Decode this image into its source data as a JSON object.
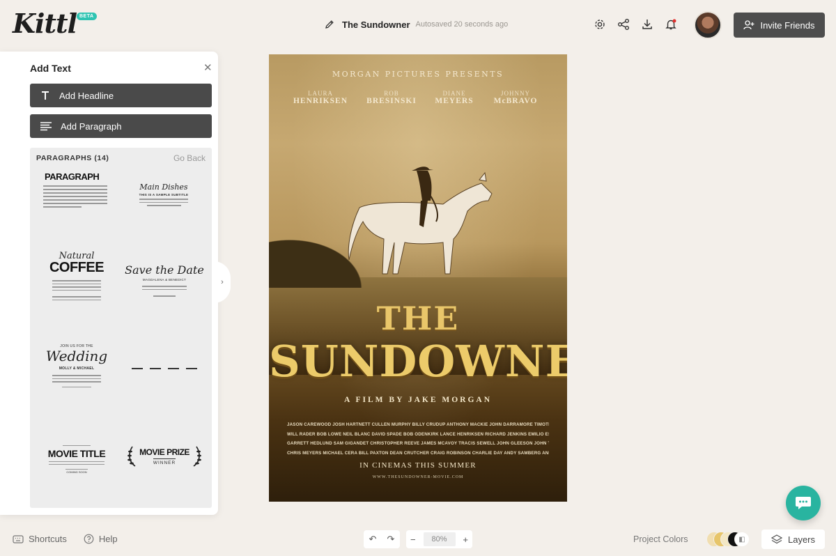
{
  "app": {
    "logo": "Kittl",
    "beta_badge": "BETA"
  },
  "document": {
    "name": "The Sundowner",
    "autosave": "Autosaved 20 seconds ago"
  },
  "header": {
    "invite_label": "Invite Friends"
  },
  "panel": {
    "title": "Add Text",
    "add_headline": "Add Headline",
    "add_paragraph": "Add Paragraph",
    "gallery_heading": "PARAGRAPHS (14)",
    "go_back": "Go Back",
    "tiles": [
      {
        "title": "PARAGRAPH"
      },
      {
        "title": "Main Dishes",
        "subtitle": "THIS IS A SAMPLE SUBTITLE"
      },
      {
        "title": "COFFEE",
        "script": "Natural"
      },
      {
        "title": "Save the Date",
        "subtitle": "MAGDALENA & BENEDICT"
      },
      {
        "title": "Wedding",
        "top": "JOIN US FOR THE",
        "subtitle": "MOLLY & MICHAEL"
      },
      {
        "title": ""
      },
      {
        "title": "MOVIE TITLE",
        "subtitle": "COMING SOON"
      },
      {
        "title": "MOVIE PRIZE",
        "subtitle": "WINNER"
      }
    ]
  },
  "poster": {
    "presents": "MORGAN PICTURES PRESENTS",
    "cast": [
      {
        "first": "LAURA",
        "last": "HENRIKSEN"
      },
      {
        "first": "ROB",
        "last": "BRESINSKI"
      },
      {
        "first": "DIANE",
        "last": "MEYERS"
      },
      {
        "first": "JOHNNY",
        "last": "McBRAVO"
      }
    ],
    "the": "THE",
    "title": "SUNDOWNER",
    "byline": "A FILM BY JAKE MORGAN",
    "credits": [
      "JASON CAREWOOD  JOSH HARTNETT  CULLEN MURPHY  BILLY CRUDUP  ANTHONY MACKIE  JOHN DARRAMORE  TIMOTHY OLYPHANT  JOSH GAD  BILLY ZANE  LUKE WILSON  KEVIN HART  PAUL RUDD",
      "WILL RADER  BOB LOWE  NEIL BLANC  DAVID SPADE  BOB ODENKIRK  LANCE HENRIKSEN  RICHARD JENKINS  EMILIO ESTEVEZ  MICHAEL ELY  JAMIE KELLY  ROY BAKER  DANNY MCBRIDE",
      "GARRETT HEDLUND  SAM GIGANDET  CHRISTOPHER REEVE  JAMES MCAVOY  TRACIS SEWELL  JOHN GLEESON  JOHN TURTURRO  JERRY LEWIS",
      "CHRIS MEYERS  MICHAEL CERA  BILL PAXTON  DEAN CRUTCHER  CRAIG ROBINSON  CHARLIE DAY  ANDY SAMBERG  ANDREW LINCOLN  EZRA MILLER  BILL PULLMAN"
    ],
    "tagline": "IN CINEMAS THIS SUMMER",
    "url": "WWW.THESUNDOWNER-MOVIE.COM"
  },
  "footer": {
    "shortcuts": "Shortcuts",
    "help": "Help",
    "zoom": "80%",
    "project_colors": "Project Colors",
    "layers": "Layers",
    "swatches": [
      "#f1deb0",
      "#e7c56a",
      "#f3e7c4",
      "#111111",
      "#ffffff"
    ]
  },
  "colors": {
    "accent": "#29b4a0",
    "dark_button": "#4a4a4a",
    "canvas_bg": "#f3efea"
  }
}
